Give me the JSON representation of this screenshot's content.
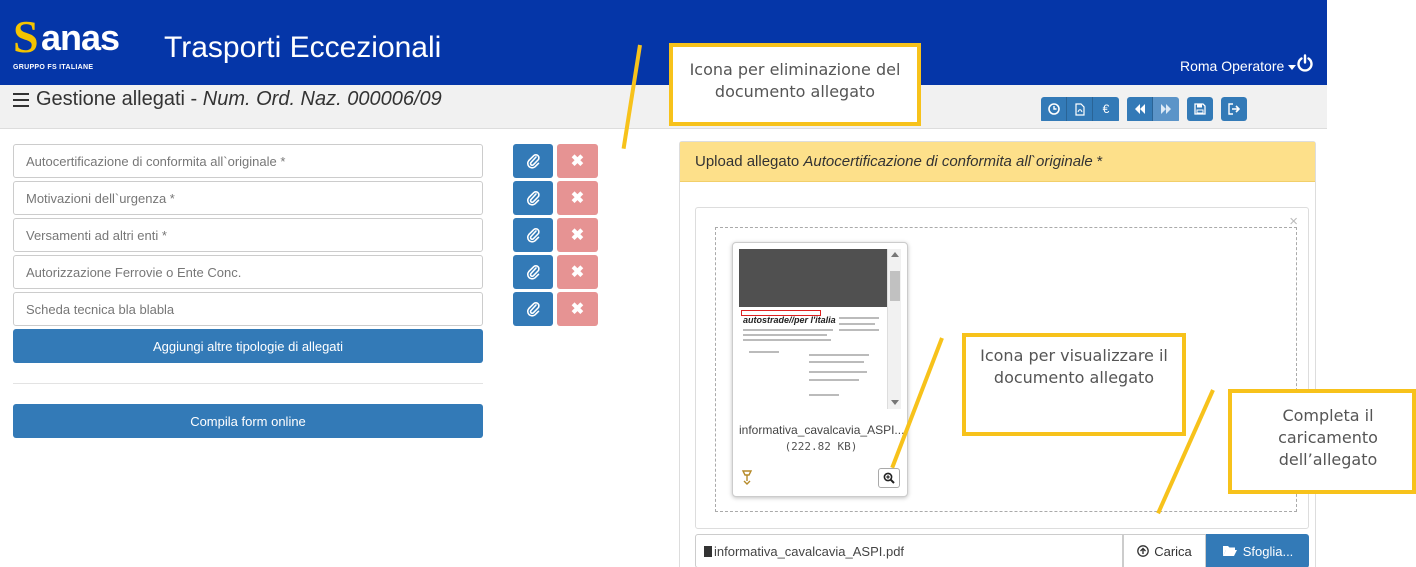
{
  "header": {
    "brand_name": "anas",
    "brand_subtitle": "GRUPPO FS ITALIANE",
    "app_title": "Trasporti Eccezionali",
    "user_name": "Roma Operatore"
  },
  "page": {
    "title_prefix": "Gestione allegati - ",
    "title_italic": "Num. Ord. Naz. 000006/09"
  },
  "toolbar": {
    "icons": [
      "clock-icon",
      "pdf-icon",
      "euro-icon",
      "backward-icon",
      "forward-icon",
      "save-icon",
      "exit-icon"
    ],
    "euro_glyph": "€"
  },
  "documents": [
    {
      "label": "Autocertificazione di conformita all`originale *"
    },
    {
      "label": "Motivazioni dell`urgenza *"
    },
    {
      "label": "Versamenti ad altri enti *"
    },
    {
      "label": "Autorizzazione Ferrovie o Ente Conc."
    },
    {
      "label": "Scheda tecnica bla blabla"
    }
  ],
  "buttons": {
    "add_types": "Aggiungi altre tipologie di allegati",
    "fill_online": "Compila form online",
    "upload": "Carica",
    "browse": "Sfoglia..."
  },
  "upload_panel": {
    "title_prefix": "Upload allegato ",
    "title_italic": "Autocertificazione di conformita all`originale",
    "title_suffix": " *",
    "close": "×",
    "file_name_short": "informativa_cavalcavia_ASPI....",
    "file_size": "(222.82 KB)",
    "file_input_value": "informativa_cavalcavia_ASPI.pdf",
    "preview_brand": "autostrade//per l'italia"
  },
  "callouts": {
    "delete": "Icona per eliminazione del documento allegato",
    "view": "Icona  per visualizzare il documento allegato",
    "complete": "Completa il caricamento dell’allegato"
  },
  "colors": {
    "header_bg": "#0536a8",
    "primary": "#337ab7",
    "danger": "#e69393",
    "panel_head": "#fde08a",
    "callout": "#f7c21b",
    "logo_accent": "#f5c400"
  }
}
